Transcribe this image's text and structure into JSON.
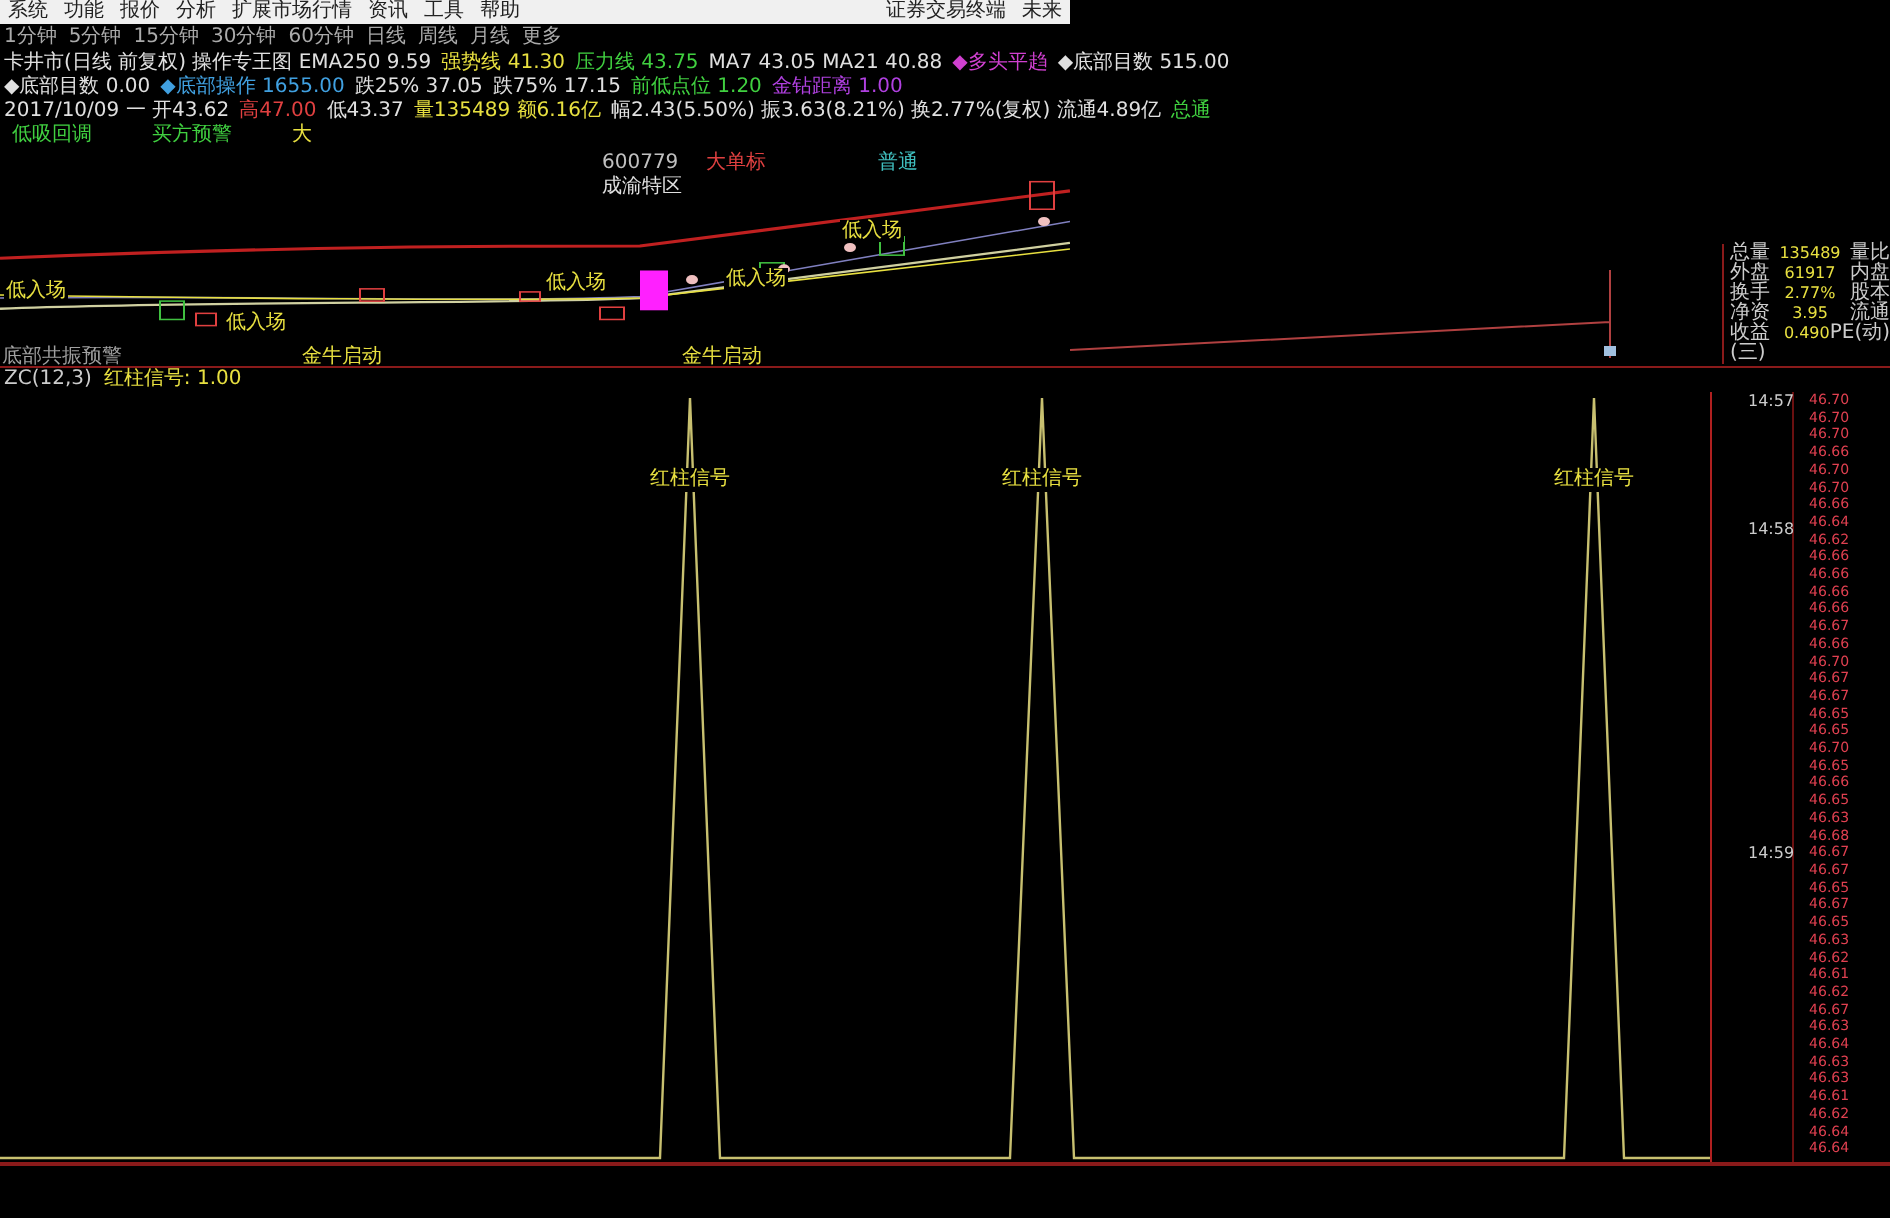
{
  "menu": {
    "items": [
      "系统",
      "功能",
      "报价",
      "分析",
      "扩展市场行情",
      "资讯",
      "工具",
      "帮助"
    ],
    "right": [
      "证券交易终端",
      "未来"
    ]
  },
  "periods": [
    "1分钟",
    "5分钟",
    "15分钟",
    "30分钟",
    "60分钟",
    "日线",
    "周线",
    "月线",
    "更多"
  ],
  "indicator_lines": [
    [
      {
        "text": "卡井市(日线 前复权) 操作专王图 EMA250 9.59",
        "color": "#e0e0e0"
      },
      {
        "text": "强势线 41.30",
        "color": "#e8e040"
      },
      {
        "text": "压力线 43.75",
        "color": "#40d040"
      },
      {
        "text": "MA7 43.05 MA21 40.88",
        "color": "#e0e0e0"
      },
      {
        "text": "◆多头平趋",
        "color": "#d040d0"
      },
      {
        "text": "◆底部目数 515.00",
        "color": "#e0e0e0"
      }
    ],
    [
      {
        "text": "◆底部目数 0.00",
        "color": "#e0e0e0"
      },
      {
        "text": "◆底部操作 1655.00",
        "color": "#40a0e0"
      },
      {
        "text": "跌25% 37.05",
        "color": "#e0e0e0"
      },
      {
        "text": "跌75% 17.15",
        "color": "#e0e0e0"
      },
      {
        "text": "前低点位 1.20",
        "color": "#40d040"
      },
      {
        "text": "金钻距离 1.00",
        "color": "#b040e0"
      }
    ],
    [
      {
        "text": "2017/10/09 一 开43.62",
        "color": "#e0e0e0"
      },
      {
        "text": "高47.00",
        "color": "#e04040"
      },
      {
        "text": "低43.37",
        "color": "#e0e0e0"
      },
      {
        "text": "量135489 额6.16亿",
        "color": "#e8e040"
      },
      {
        "text": "幅2.43(5.50%) 振3.63(8.21%) 换2.77%(复权) 流通4.89亿",
        "color": "#e0e0e0"
      },
      {
        "text": "总通",
        "color": "#40d040"
      }
    ]
  ],
  "legend": [
    {
      "text": "低吸回调",
      "color": "#40d040"
    },
    {
      "text": "买方预警",
      "color": "#40d040"
    },
    {
      "text": "大",
      "color": "#e8e040"
    }
  ],
  "chart_labels": [
    {
      "text": "600779",
      "color": "#c0c0c0"
    },
    {
      "text": "大单标",
      "color": "#e04040"
    },
    {
      "text": "普通",
      "color": "#40c0c0"
    },
    {
      "text": "成渝特区",
      "color": "#e0e0e0"
    },
    {
      "text": "低入场",
      "color": "#e8e040"
    },
    {
      "text": "低入场",
      "color": "#e8e040"
    },
    {
      "text": "低入场",
      "color": "#e8e040"
    },
    {
      "text": "低入场",
      "color": "#e8e040"
    },
    {
      "text": "低入场",
      "color": "#e8e040"
    },
    {
      "text": "底部共振预警",
      "color": "#a0a0a0"
    },
    {
      "text": "金牛启动",
      "color": "#e8e040"
    },
    {
      "text": "金牛启动",
      "color": "#e8e040"
    }
  ],
  "sub_indicator": {
    "name": "ZC(12,3)",
    "label": "红柱信号: 1.00"
  },
  "info": [
    {
      "label": "总量",
      "value": "135489",
      "unit": "量比"
    },
    {
      "label": "外盘",
      "value": "61917",
      "unit": "内盘"
    },
    {
      "label": "换手",
      "value": "2.77%",
      "unit": "股本"
    },
    {
      "label": "净资",
      "value": "3.95",
      "unit": "流通"
    },
    {
      "label": "收益(三)",
      "value": "0.490",
      "unit": "PE(动)"
    }
  ],
  "signal_labels": [
    "红柱信号",
    "红柱信号",
    "红柱信号"
  ],
  "ticks": {
    "times": [
      "14:57",
      "14:58",
      "14:59"
    ],
    "prices": [
      "46.70",
      "46.70",
      "46.70",
      "46.66",
      "46.70",
      "46.70",
      "46.66",
      "46.64",
      "46.62",
      "46.66",
      "46.66",
      "46.66",
      "46.66",
      "46.67",
      "46.66",
      "46.70",
      "46.67",
      "46.67",
      "46.65",
      "46.65",
      "46.70",
      "46.65",
      "46.66",
      "46.65",
      "46.63",
      "46.68",
      "46.67",
      "46.67",
      "46.65",
      "46.67",
      "46.65",
      "46.63",
      "46.62",
      "46.61",
      "46.62",
      "46.67",
      "46.63",
      "46.64",
      "46.63",
      "46.63",
      "46.61",
      "46.62",
      "46.64",
      "46.64"
    ]
  }
}
